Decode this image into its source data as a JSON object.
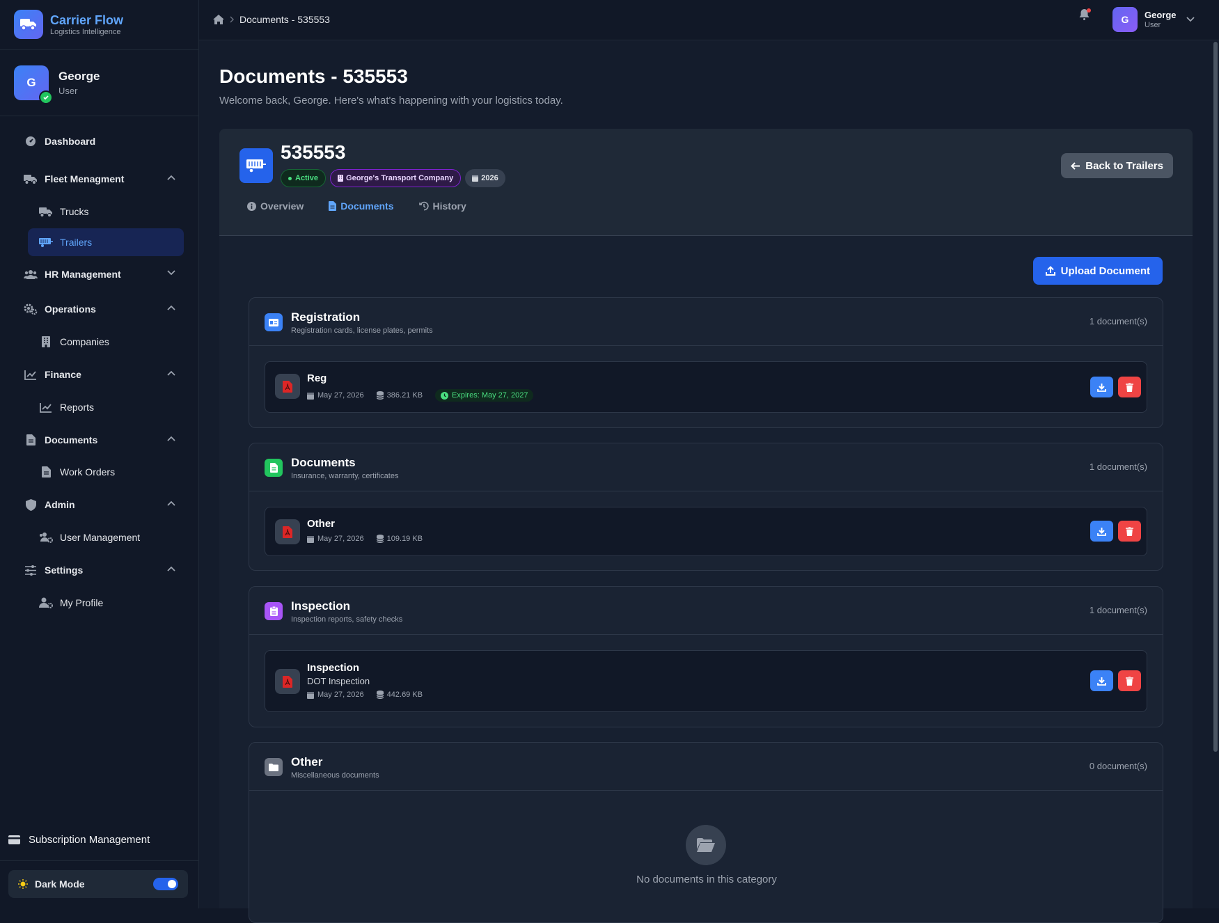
{
  "brand": {
    "name": "Carrier Flow",
    "tagline": "Logistics Intelligence"
  },
  "user": {
    "initial": "G",
    "name": "George",
    "role": "User"
  },
  "nav": {
    "dashboard": "Dashboard",
    "fleet": "Fleet Menagment",
    "trucks": "Trucks",
    "trailers": "Trailers",
    "hr": "HR Management",
    "operations": "Operations",
    "companies": "Companies",
    "finance": "Finance",
    "reports": "Reports",
    "documents": "Documents",
    "work_orders": "Work Orders",
    "admin": "Admin",
    "user_management": "User Management",
    "settings": "Settings",
    "my_profile": "My Profile",
    "subscription": "Subscription Management",
    "dark_mode": "Dark Mode"
  },
  "topbar": {
    "breadcrumb": "Documents - 535553",
    "user_initial": "G",
    "user_name": "George",
    "user_role": "User"
  },
  "page": {
    "title": "Documents - 535553",
    "subtitle": "Welcome back, George. Here's what's happening with your logistics today."
  },
  "trailer": {
    "number": "535553",
    "status": "Active",
    "company": "George's Transport Company",
    "year": "2026",
    "back_label": "Back to Trailers"
  },
  "tabs": [
    "Overview",
    "Documents",
    "History"
  ],
  "upload_label": "Upload Document",
  "categories": [
    {
      "title": "Registration",
      "desc": "Registration cards, license plates, permits",
      "count": "1 document(s)",
      "color": "#3b82f6",
      "doc": {
        "name": "Reg",
        "date": "May 27, 2026",
        "size": "386.21 KB",
        "expires": "Expires: May 27, 2027"
      }
    },
    {
      "title": "Documents",
      "desc": "Insurance, warranty, certificates",
      "count": "1 document(s)",
      "color": "#22c55e",
      "doc": {
        "name": "Other",
        "date": "May 27, 2026",
        "size": "109.19 KB"
      }
    },
    {
      "title": "Inspection",
      "desc": "Inspection reports, safety checks",
      "count": "1 document(s)",
      "color": "#a855f7",
      "doc": {
        "name": "Inspection",
        "note": "DOT Inspection",
        "date": "May 27, 2026",
        "size": "442.69 KB"
      }
    },
    {
      "title": "Other",
      "desc": "Miscellaneous documents",
      "count": "0 document(s)",
      "color": "#6b7280",
      "empty": "No documents in this category"
    }
  ],
  "colors": {
    "accent": "#2563eb",
    "success": "#22c55e",
    "danger": "#ef4444",
    "panel": "#1f2937"
  }
}
